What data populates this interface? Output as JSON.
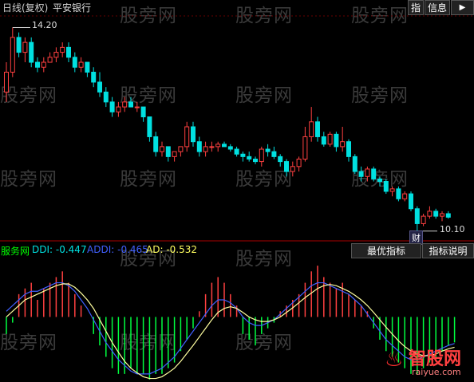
{
  "header": {
    "period_label": "日线(复权)",
    "stock_name": "平安银行"
  },
  "buttons": {
    "indicator": "指",
    "info": "信息",
    "arrow": "▶"
  },
  "price_panel": {
    "high_label": "14.20",
    "low_label": "10.10",
    "finance_marker": "财"
  },
  "indicator_panel": {
    "source_label": "服务网",
    "items": [
      {
        "key": "DDI:",
        "value": "-0.447",
        "color": "#00e0e0"
      },
      {
        "key": "ADDI:",
        "value": "-0.465",
        "color": "#4060ff"
      },
      {
        "key": "AD:",
        "value": "-0.532",
        "color": "#ffff60"
      }
    ],
    "best_button": "最优指标",
    "help_button": "指标说明"
  },
  "watermark": "股旁网",
  "brand": {
    "name": "智股网",
    "url": "raiyue.com"
  },
  "colors": {
    "up": "#ff4040",
    "down": "#00e0e0",
    "ddi_pos": "#ff4040",
    "ddi_neg": "#00ff40",
    "addi": "#4060ff",
    "ad": "#ffffa0"
  },
  "chart_data": {
    "type": "candlestick",
    "candles": [
      {
        "o": 12.9,
        "h": 13.5,
        "l": 12.7,
        "c": 13.3
      },
      {
        "o": 13.3,
        "h": 14.2,
        "l": 13.2,
        "c": 14.0
      },
      {
        "o": 14.0,
        "h": 14.1,
        "l": 13.6,
        "c": 13.7
      },
      {
        "o": 13.7,
        "h": 14.0,
        "l": 13.5,
        "c": 13.9
      },
      {
        "o": 13.9,
        "h": 14.0,
        "l": 13.4,
        "c": 13.5
      },
      {
        "o": 13.5,
        "h": 13.6,
        "l": 13.3,
        "c": 13.4
      },
      {
        "o": 13.4,
        "h": 13.6,
        "l": 13.3,
        "c": 13.5
      },
      {
        "o": 13.5,
        "h": 13.7,
        "l": 13.5,
        "c": 13.6
      },
      {
        "o": 13.6,
        "h": 13.8,
        "l": 13.5,
        "c": 13.7
      },
      {
        "o": 13.7,
        "h": 13.9,
        "l": 13.6,
        "c": 13.8
      },
      {
        "o": 13.8,
        "h": 13.9,
        "l": 13.5,
        "c": 13.6
      },
      {
        "o": 13.6,
        "h": 13.7,
        "l": 13.3,
        "c": 13.4
      },
      {
        "o": 13.4,
        "h": 13.6,
        "l": 13.3,
        "c": 13.5
      },
      {
        "o": 13.5,
        "h": 13.5,
        "l": 13.2,
        "c": 13.3
      },
      {
        "o": 13.3,
        "h": 13.4,
        "l": 13.0,
        "c": 13.1
      },
      {
        "o": 13.1,
        "h": 13.3,
        "l": 12.8,
        "c": 12.9
      },
      {
        "o": 12.9,
        "h": 13.0,
        "l": 12.6,
        "c": 12.7
      },
      {
        "o": 12.7,
        "h": 12.8,
        "l": 12.4,
        "c": 12.5
      },
      {
        "o": 12.5,
        "h": 12.7,
        "l": 12.4,
        "c": 12.6
      },
      {
        "o": 12.6,
        "h": 12.8,
        "l": 12.5,
        "c": 12.7
      },
      {
        "o": 12.7,
        "h": 12.8,
        "l": 12.6,
        "c": 12.6
      },
      {
        "o": 12.6,
        "h": 12.7,
        "l": 12.5,
        "c": 12.6
      },
      {
        "o": 12.6,
        "h": 12.6,
        "l": 12.3,
        "c": 12.4
      },
      {
        "o": 12.4,
        "h": 12.4,
        "l": 11.9,
        "c": 12.0
      },
      {
        "o": 12.0,
        "h": 12.1,
        "l": 11.6,
        "c": 11.7
      },
      {
        "o": 11.7,
        "h": 11.9,
        "l": 11.6,
        "c": 11.8
      },
      {
        "o": 11.8,
        "h": 11.8,
        "l": 11.5,
        "c": 11.6
      },
      {
        "o": 11.6,
        "h": 11.7,
        "l": 11.5,
        "c": 11.7
      },
      {
        "o": 11.7,
        "h": 11.8,
        "l": 11.6,
        "c": 11.8
      },
      {
        "o": 11.8,
        "h": 12.3,
        "l": 11.7,
        "c": 12.2
      },
      {
        "o": 12.2,
        "h": 12.3,
        "l": 11.8,
        "c": 11.9
      },
      {
        "o": 11.9,
        "h": 12.0,
        "l": 11.6,
        "c": 11.7
      },
      {
        "o": 11.7,
        "h": 11.9,
        "l": 11.6,
        "c": 11.8
      },
      {
        "o": 11.8,
        "h": 11.9,
        "l": 11.7,
        "c": 11.8
      },
      {
        "o": 11.8,
        "h": 11.9,
        "l": 11.7,
        "c": 11.85
      },
      {
        "o": 11.85,
        "h": 11.9,
        "l": 11.8,
        "c": 11.8
      },
      {
        "o": 11.8,
        "h": 11.85,
        "l": 11.7,
        "c": 11.75
      },
      {
        "o": 11.75,
        "h": 11.8,
        "l": 11.6,
        "c": 11.65
      },
      {
        "o": 11.65,
        "h": 11.7,
        "l": 11.5,
        "c": 11.6
      },
      {
        "o": 11.6,
        "h": 11.7,
        "l": 11.5,
        "c": 11.55
      },
      {
        "o": 11.55,
        "h": 11.6,
        "l": 11.45,
        "c": 11.5
      },
      {
        "o": 11.5,
        "h": 11.8,
        "l": 11.4,
        "c": 11.75
      },
      {
        "o": 11.75,
        "h": 11.85,
        "l": 11.6,
        "c": 11.7
      },
      {
        "o": 11.7,
        "h": 11.8,
        "l": 11.55,
        "c": 11.6
      },
      {
        "o": 11.6,
        "h": 11.65,
        "l": 11.4,
        "c": 11.5
      },
      {
        "o": 11.5,
        "h": 11.55,
        "l": 11.2,
        "c": 11.3
      },
      {
        "o": 11.3,
        "h": 11.5,
        "l": 11.2,
        "c": 11.4
      },
      {
        "o": 11.4,
        "h": 11.6,
        "l": 11.3,
        "c": 11.55
      },
      {
        "o": 11.55,
        "h": 12.2,
        "l": 11.5,
        "c": 12.0
      },
      {
        "o": 12.0,
        "h": 12.6,
        "l": 11.9,
        "c": 12.3
      },
      {
        "o": 12.3,
        "h": 12.4,
        "l": 11.9,
        "c": 12.0
      },
      {
        "o": 12.0,
        "h": 12.1,
        "l": 11.8,
        "c": 11.85
      },
      {
        "o": 11.85,
        "h": 12.1,
        "l": 11.8,
        "c": 12.05
      },
      {
        "o": 12.05,
        "h": 12.1,
        "l": 11.7,
        "c": 11.8
      },
      {
        "o": 11.8,
        "h": 12.2,
        "l": 11.7,
        "c": 11.9
      },
      {
        "o": 11.9,
        "h": 11.95,
        "l": 11.5,
        "c": 11.6
      },
      {
        "o": 11.6,
        "h": 11.65,
        "l": 11.25,
        "c": 11.3
      },
      {
        "o": 11.3,
        "h": 11.4,
        "l": 11.1,
        "c": 11.2
      },
      {
        "o": 11.2,
        "h": 11.4,
        "l": 11.1,
        "c": 11.35
      },
      {
        "o": 11.35,
        "h": 11.4,
        "l": 11.1,
        "c": 11.15
      },
      {
        "o": 11.15,
        "h": 11.2,
        "l": 11.0,
        "c": 11.1
      },
      {
        "o": 11.1,
        "h": 11.15,
        "l": 10.85,
        "c": 10.9
      },
      {
        "o": 10.9,
        "h": 11.0,
        "l": 10.8,
        "c": 10.95
      },
      {
        "o": 10.95,
        "h": 11.0,
        "l": 10.7,
        "c": 10.75
      },
      {
        "o": 10.75,
        "h": 10.9,
        "l": 10.7,
        "c": 10.85
      },
      {
        "o": 10.85,
        "h": 10.9,
        "l": 10.5,
        "c": 10.55
      },
      {
        "o": 10.55,
        "h": 10.6,
        "l": 10.1,
        "c": 10.25
      },
      {
        "o": 10.25,
        "h": 10.45,
        "l": 10.2,
        "c": 10.4
      },
      {
        "o": 10.4,
        "h": 10.6,
        "l": 10.35,
        "c": 10.5
      },
      {
        "o": 10.5,
        "h": 10.55,
        "l": 10.35,
        "c": 10.4
      },
      {
        "o": 10.4,
        "h": 10.5,
        "l": 10.3,
        "c": 10.45
      },
      {
        "o": 10.45,
        "h": 10.5,
        "l": 10.35,
        "c": 10.38
      }
    ],
    "ddi": [
      -0.3,
      -0.1,
      0.4,
      0.5,
      0.6,
      0.3,
      0.5,
      0.6,
      0.7,
      0.8,
      0.6,
      0.4,
      0.2,
      0.0,
      -0.3,
      -0.5,
      -0.7,
      -0.9,
      -1.0,
      -1.0,
      -0.9,
      -1.0,
      -1.0,
      -1.1,
      -1.0,
      -1.0,
      -0.9,
      -0.8,
      -0.6,
      -0.4,
      -0.2,
      0.1,
      0.4,
      0.6,
      0.7,
      0.6,
      0.4,
      0.2,
      -0.3,
      -0.4,
      -0.5,
      -0.3,
      -0.2,
      -0.1,
      0.1,
      0.2,
      0.3,
      0.4,
      0.6,
      0.8,
      0.9,
      0.7,
      0.6,
      0.5,
      0.6,
      0.4,
      0.3,
      0.2,
      0.1,
      -0.2,
      -0.4,
      -0.6,
      -0.7,
      -0.8,
      -0.9,
      -1.0,
      -1.0,
      -0.9,
      -0.8,
      -0.7,
      -0.6,
      -0.5,
      -0.447
    ],
    "addi": [
      0.1,
      0.2,
      0.3,
      0.4,
      0.45,
      0.45,
      0.5,
      0.55,
      0.6,
      0.6,
      0.55,
      0.45,
      0.3,
      0.15,
      -0.05,
      -0.25,
      -0.45,
      -0.6,
      -0.75,
      -0.85,
      -0.95,
      -1.0,
      -1.0,
      -1.0,
      -0.95,
      -0.9,
      -0.8,
      -0.7,
      -0.55,
      -0.4,
      -0.25,
      -0.1,
      0.05,
      0.2,
      0.3,
      0.3,
      0.25,
      0.15,
      0.0,
      -0.1,
      -0.15,
      -0.15,
      -0.1,
      -0.05,
      0.05,
      0.15,
      0.25,
      0.35,
      0.45,
      0.55,
      0.6,
      0.6,
      0.55,
      0.5,
      0.45,
      0.4,
      0.3,
      0.2,
      0.05,
      -0.1,
      -0.25,
      -0.4,
      -0.5,
      -0.6,
      -0.7,
      -0.75,
      -0.75,
      -0.7,
      -0.65,
      -0.6,
      -0.55,
      -0.5,
      -0.465
    ],
    "ad": [
      0.0,
      0.1,
      0.2,
      0.3,
      0.35,
      0.4,
      0.45,
      0.5,
      0.55,
      0.58,
      0.58,
      0.52,
      0.42,
      0.3,
      0.15,
      -0.05,
      -0.25,
      -0.45,
      -0.62,
      -0.78,
      -0.9,
      -0.98,
      -1.05,
      -1.08,
      -1.08,
      -1.05,
      -0.98,
      -0.9,
      -0.78,
      -0.64,
      -0.5,
      -0.35,
      -0.2,
      -0.05,
      0.08,
      0.15,
      0.18,
      0.15,
      0.08,
      0.0,
      -0.05,
      -0.08,
      -0.08,
      -0.05,
      0.0,
      0.08,
      0.16,
      0.25,
      0.34,
      0.42,
      0.5,
      0.55,
      0.57,
      0.55,
      0.5,
      0.45,
      0.38,
      0.3,
      0.2,
      0.08,
      -0.05,
      -0.18,
      -0.3,
      -0.42,
      -0.52,
      -0.6,
      -0.65,
      -0.68,
      -0.68,
      -0.65,
      -0.6,
      -0.56,
      -0.532
    ]
  }
}
